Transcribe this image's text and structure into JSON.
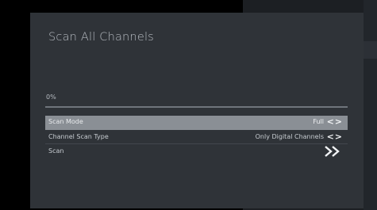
{
  "dialog": {
    "title": "Scan All Channels",
    "progress": {
      "label": "0%",
      "value": 0
    }
  },
  "options": [
    {
      "label": "Scan Mode",
      "value": "Full",
      "control_glyph": "<>",
      "selected": true
    },
    {
      "label": "Channel Scan Type",
      "value": "Only Digital Channels",
      "control_glyph": "<>",
      "selected": false
    },
    {
      "label": "Scan",
      "action_icon": "double-chevron-right-icon",
      "selected": false
    }
  ],
  "colors": {
    "dialog_bg": "#2f3338",
    "selected_row": "#8a8f95",
    "text": "#c7ccd1",
    "screen_bg": "#000000"
  }
}
